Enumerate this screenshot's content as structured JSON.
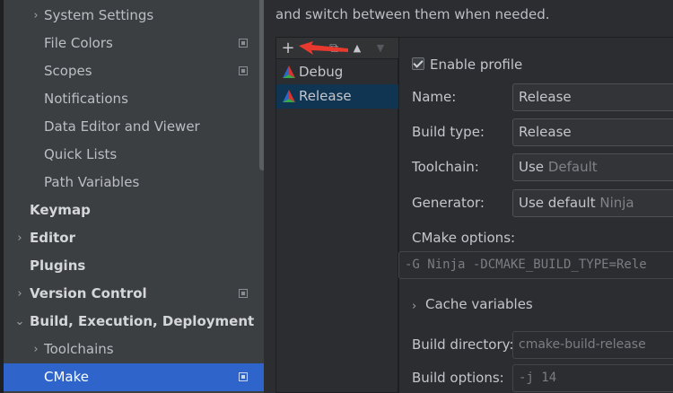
{
  "sidebar": {
    "items": [
      {
        "label": "System Settings",
        "expander": "›"
      },
      {
        "label": "File Colors"
      },
      {
        "label": "Scopes"
      },
      {
        "label": "Notifications"
      },
      {
        "label": "Data Editor and Viewer"
      },
      {
        "label": "Quick Lists"
      },
      {
        "label": "Path Variables"
      },
      {
        "label": "Keymap"
      },
      {
        "label": "Editor",
        "expander": "›"
      },
      {
        "label": "Plugins"
      },
      {
        "label": "Version Control",
        "expander": "›"
      },
      {
        "label": "Build, Execution, Deployment",
        "expander": "⌄"
      },
      {
        "label": "Toolchains",
        "expander": "›"
      },
      {
        "label": "CMake"
      }
    ]
  },
  "content": {
    "description": "and switch between them when needed.",
    "toolbar": {
      "add": "+",
      "copy": "⧉",
      "up": "▲",
      "down": "▼"
    },
    "profiles": [
      {
        "label": "Debug"
      },
      {
        "label": "Release"
      }
    ],
    "form": {
      "enable_label": "Enable profile",
      "name_label": "Name:",
      "name_value": "Release",
      "build_type_label": "Build type:",
      "build_type_value": "Release",
      "toolchain_label": "Toolchain:",
      "toolchain_value": "Use",
      "toolchain_hint": "Default",
      "generator_label": "Generator:",
      "generator_value": "Use default",
      "generator_hint": "Ninja",
      "cmake_options_label": "CMake options:",
      "cmake_options_value": "-G Ninja -DCMAKE_BUILD_TYPE=Rele",
      "cache_variables_label": "Cache variables",
      "cache_variables_expander": "›",
      "build_dir_label": "Build directory:",
      "build_dir_value": "cmake-build-release",
      "build_options_label": "Build options:",
      "build_options_value": "-j 14"
    }
  },
  "colors": {
    "selection": "#2f65ca",
    "profile_selection": "#0f3553",
    "annotation_arrow": "#e8392f"
  }
}
